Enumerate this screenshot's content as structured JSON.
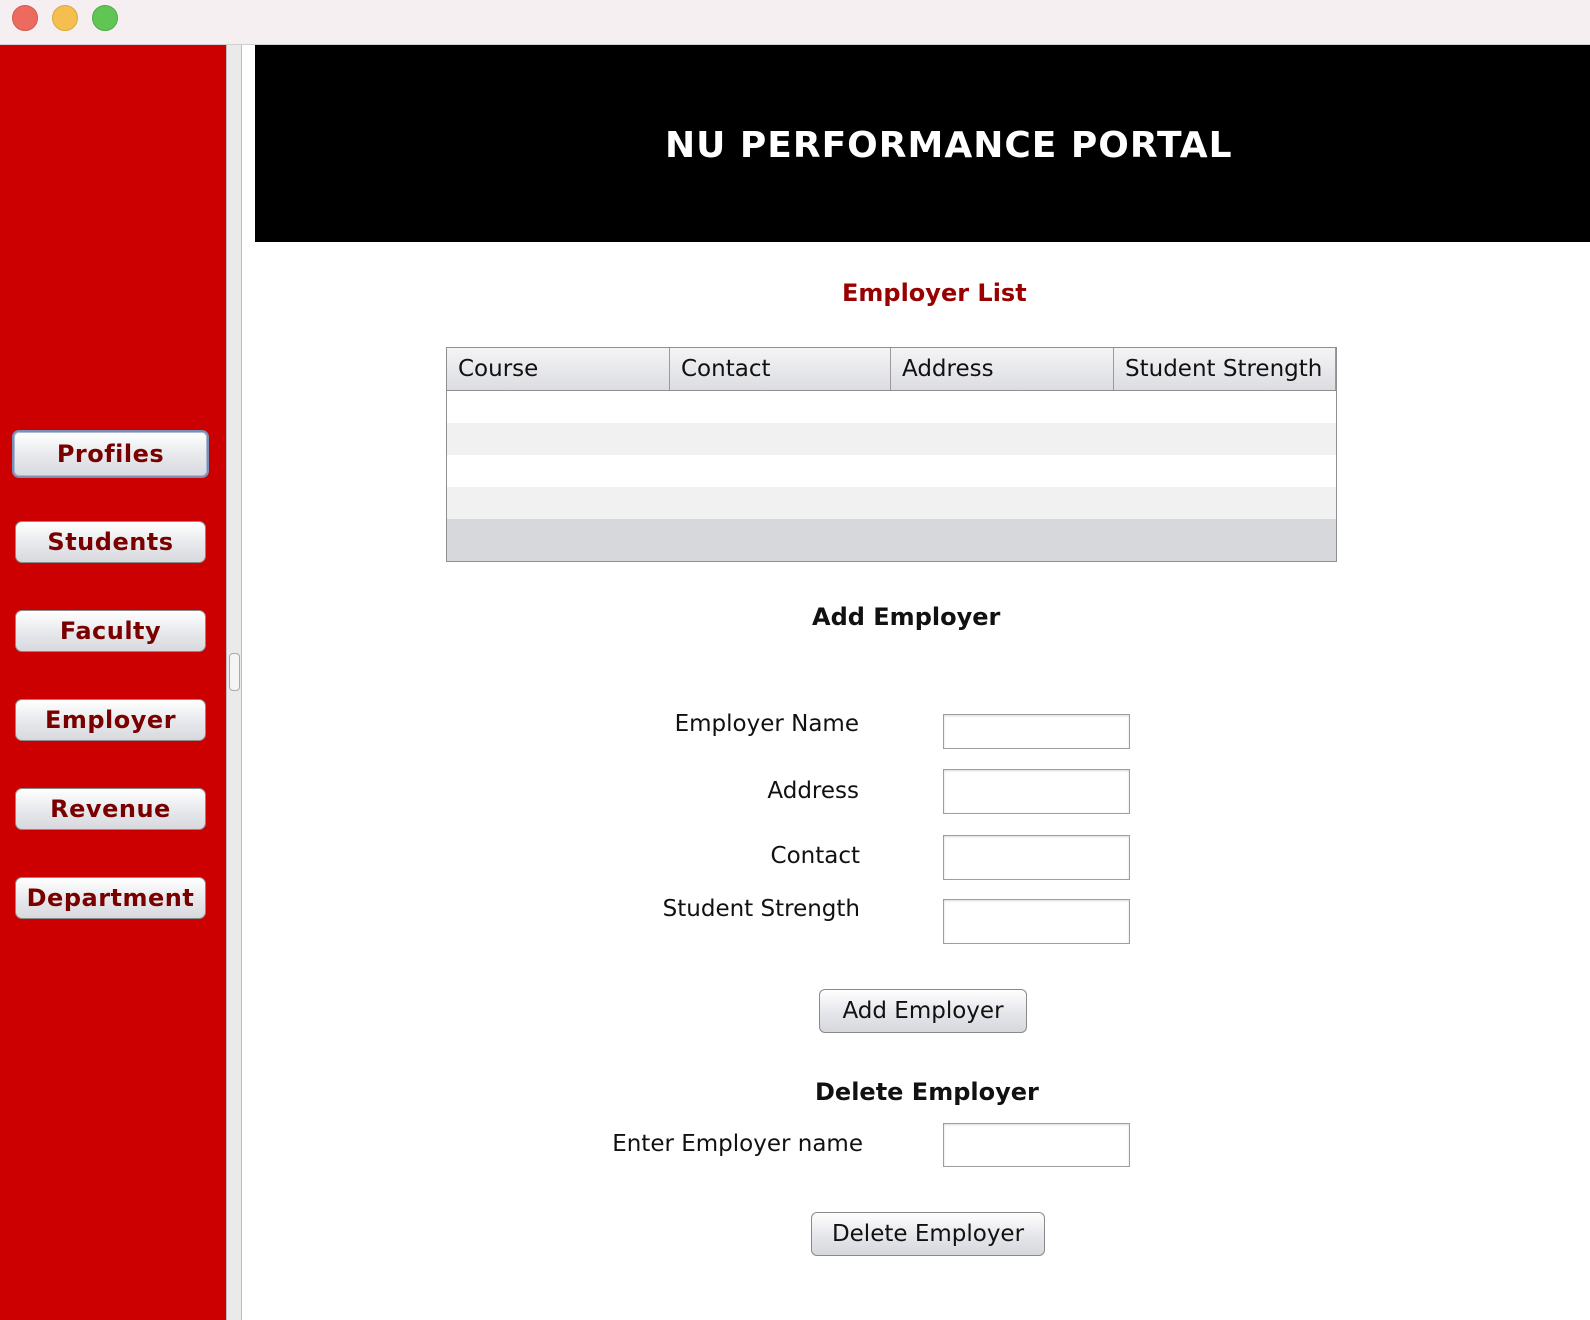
{
  "window": {
    "controls": [
      "close",
      "minimize",
      "zoom"
    ]
  },
  "sidebar": {
    "items": [
      {
        "label": "Profiles",
        "active": true
      },
      {
        "label": "Students"
      },
      {
        "label": "Faculty"
      },
      {
        "label": "Employer"
      },
      {
        "label": "Revenue"
      },
      {
        "label": "Department"
      }
    ]
  },
  "header": {
    "title": "NU PERFORMANCE PORTAL"
  },
  "employer_list": {
    "title": "Employer List",
    "columns": [
      "Course",
      "Contact",
      "Address",
      "Student Strength"
    ],
    "rows": []
  },
  "add_employer": {
    "title": "Add Employer",
    "fields": [
      {
        "label": "Employer Name",
        "value": ""
      },
      {
        "label": "Address",
        "value": ""
      },
      {
        "label": "Contact",
        "value": ""
      },
      {
        "label": "Student Strength",
        "value": ""
      }
    ],
    "button": "Add Employer"
  },
  "delete_employer": {
    "title": "Delete Employer",
    "field": {
      "label": "Enter Employer name",
      "value": ""
    },
    "button": "Delete Employer"
  },
  "colors": {
    "sidebar": "#cc0000",
    "nav_text": "#7a0000",
    "header_bg": "#000000",
    "list_title": "#990000"
  }
}
